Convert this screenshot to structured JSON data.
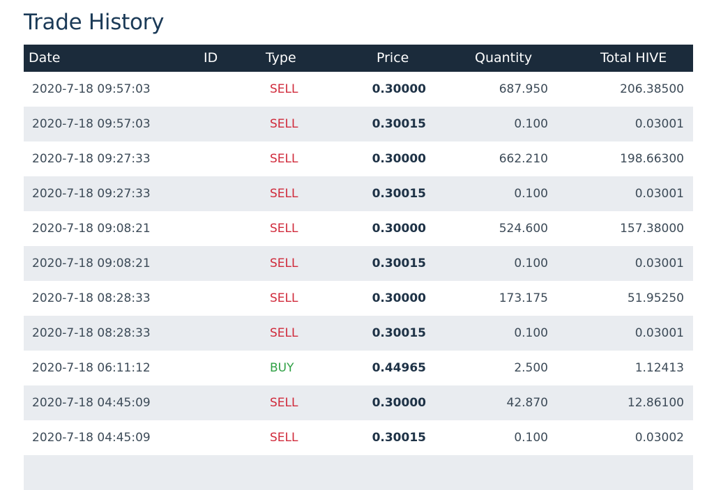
{
  "page": {
    "title": "Trade History"
  },
  "table": {
    "headers": {
      "date": "Date",
      "id": "ID",
      "type": "Type",
      "price": "Price",
      "quantity": "Quantity",
      "total": "Total HIVE"
    },
    "rows": [
      {
        "date": "2020-7-18 09:57:03",
        "type": "SELL",
        "price": "0.30000",
        "quantity": "687.950",
        "total": "206.38500"
      },
      {
        "date": "2020-7-18 09:57:03",
        "type": "SELL",
        "price": "0.30015",
        "quantity": "0.100",
        "total": "0.03001"
      },
      {
        "date": "2020-7-18 09:27:33",
        "type": "SELL",
        "price": "0.30000",
        "quantity": "662.210",
        "total": "198.66300"
      },
      {
        "date": "2020-7-18 09:27:33",
        "type": "SELL",
        "price": "0.30015",
        "quantity": "0.100",
        "total": "0.03001"
      },
      {
        "date": "2020-7-18 09:08:21",
        "type": "SELL",
        "price": "0.30000",
        "quantity": "524.600",
        "total": "157.38000"
      },
      {
        "date": "2020-7-18 09:08:21",
        "type": "SELL",
        "price": "0.30015",
        "quantity": "0.100",
        "total": "0.03001"
      },
      {
        "date": "2020-7-18 08:28:33",
        "type": "SELL",
        "price": "0.30000",
        "quantity": "173.175",
        "total": "51.95250"
      },
      {
        "date": "2020-7-18 08:28:33",
        "type": "SELL",
        "price": "0.30015",
        "quantity": "0.100",
        "total": "0.03001"
      },
      {
        "date": "2020-7-18 06:11:12",
        "type": "BUY",
        "price": "0.44965",
        "quantity": "2.500",
        "total": "1.12413"
      },
      {
        "date": "2020-7-18 04:45:09",
        "type": "SELL",
        "price": "0.30000",
        "quantity": "42.870",
        "total": "12.86100"
      },
      {
        "date": "2020-7-18 04:45:09",
        "type": "SELL",
        "price": "0.30015",
        "quantity": "0.100",
        "total": "0.03002"
      },
      {
        "date": "",
        "type": "",
        "price": "",
        "quantity": "",
        "total": ""
      }
    ]
  },
  "colors": {
    "sell": "#d02a3b",
    "buy": "#2fa044",
    "header_bg": "#1b2b3b",
    "stripe_bg": "#e9ecf0"
  }
}
